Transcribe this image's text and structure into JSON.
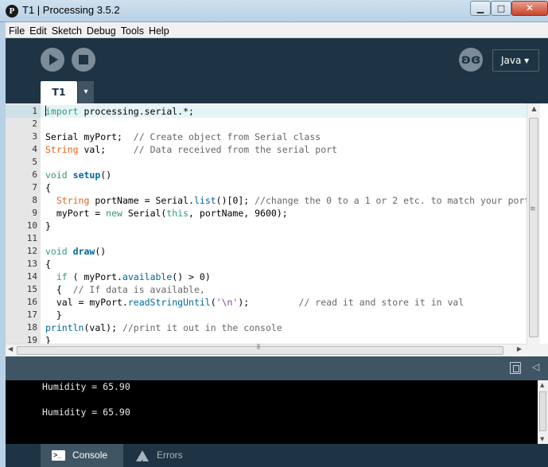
{
  "window": {
    "title": "T1 | Processing 3.5.2",
    "app_icon": "processing-logo-icon",
    "minimize": "minimize-icon",
    "maximize": "maximize-icon",
    "close": "close-icon"
  },
  "menu": [
    "File",
    "Edit",
    "Sketch",
    "Debug",
    "Tools",
    "Help"
  ],
  "toolbar": {
    "run_icon": "play-icon",
    "stop_icon": "stop-icon",
    "debug_icon": "debugger-butterfly-icon",
    "mode": "Java ▾"
  },
  "tabs": {
    "active": "T1",
    "menu_glyph": "▾"
  },
  "editor": {
    "current_line": 1,
    "lines": [
      "1",
      "2",
      "3",
      "4",
      "5",
      "6",
      "7",
      "8",
      "9",
      "10",
      "11",
      "12",
      "13",
      "14",
      "15",
      "16",
      "17",
      "18",
      "19"
    ]
  },
  "console": {
    "lines": [
      "Humidity = 65.90",
      "Humidity = 65.90"
    ]
  },
  "footer": {
    "console_label": "Console",
    "errors_label": "Errors"
  },
  "colors": {
    "chrome": "#1e3444",
    "panel": "#3f5564",
    "keyword": "#33997e",
    "type": "#e2661a",
    "function": "#006699",
    "comment": "#666666",
    "string": "#7d4793"
  }
}
